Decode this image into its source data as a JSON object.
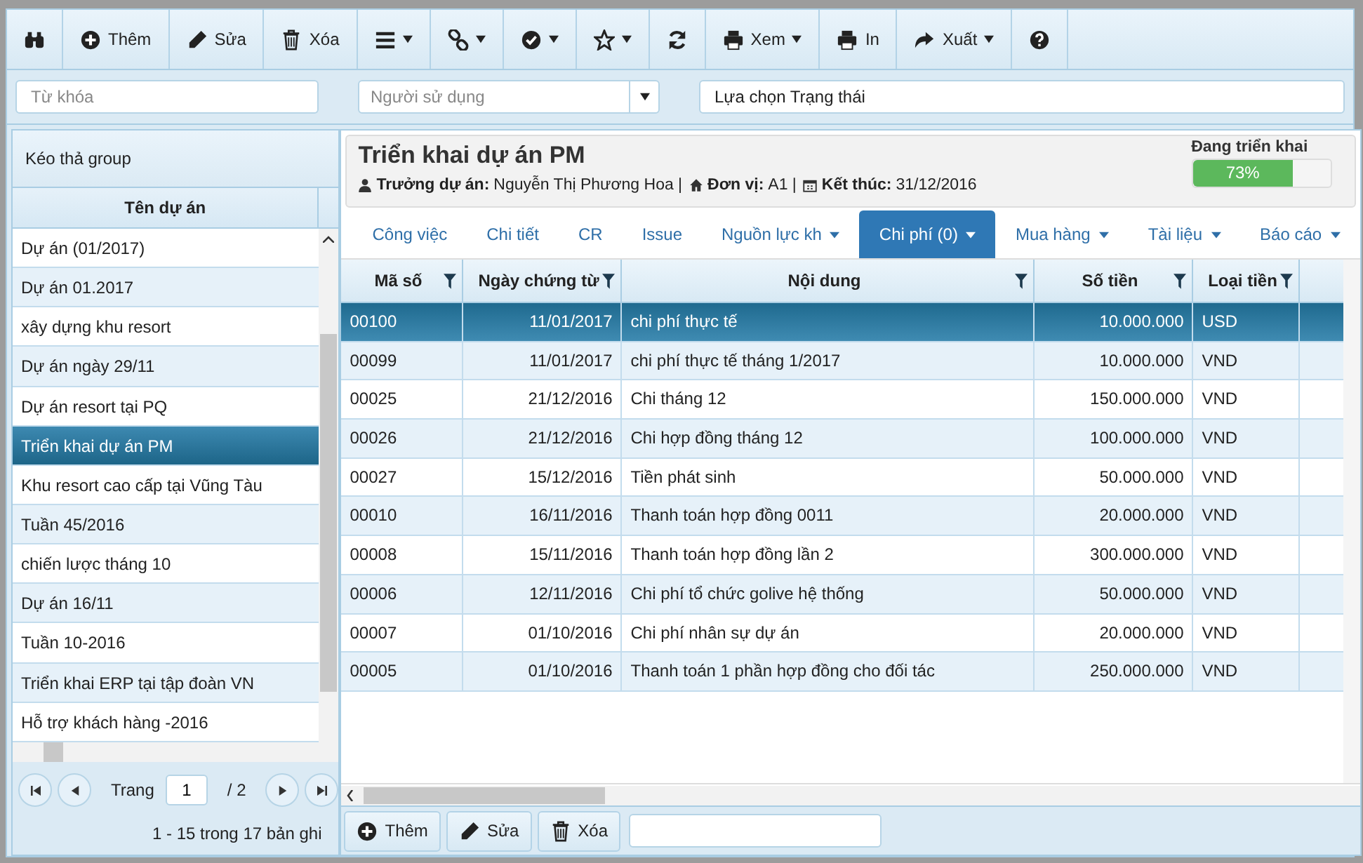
{
  "toolbar": [
    {
      "kind": "binoculars",
      "caret": false
    },
    {
      "kind": "plus",
      "label": "Thêm",
      "caret": false
    },
    {
      "kind": "pencil",
      "label": "Sửa",
      "caret": false
    },
    {
      "kind": "trash",
      "label": "Xóa",
      "caret": false
    },
    {
      "kind": "list",
      "caret": true
    },
    {
      "kind": "link",
      "caret": true
    },
    {
      "kind": "check",
      "caret": true
    },
    {
      "kind": "star",
      "caret": true
    },
    {
      "kind": "refresh",
      "caret": false
    },
    {
      "kind": "printer",
      "label": "Xem",
      "caret": true
    },
    {
      "kind": "printer",
      "label": "In",
      "caret": false
    },
    {
      "kind": "share",
      "label": "Xuất",
      "caret": true
    },
    {
      "kind": "help",
      "caret": false
    }
  ],
  "filters": {
    "keyword": {
      "placeholder": "Từ khóa"
    },
    "user": {
      "placeholder": "Người sử dụng"
    },
    "status": {
      "value": "Lựa chọn Trạng thái"
    }
  },
  "project_list": {
    "group_hint": "Kéo thả group",
    "column": "Tên dự án",
    "items": [
      {
        "name": "Dự án (01/2017)",
        "selected": false
      },
      {
        "name": "Dự án 01.2017",
        "selected": false
      },
      {
        "name": "xây dựng khu resort",
        "selected": false
      },
      {
        "name": "Dự án ngày 29/11",
        "selected": false
      },
      {
        "name": "Dự án resort tại PQ",
        "selected": false
      },
      {
        "name": "Triển khai dự án PM",
        "selected": true
      },
      {
        "name": "Khu resort cao cấp tại Vũng Tàu",
        "selected": false
      },
      {
        "name": "Tuần 45/2016",
        "selected": false
      },
      {
        "name": "chiến lược tháng 10",
        "selected": false
      },
      {
        "name": "Dự án 16/11",
        "selected": false
      },
      {
        "name": "Tuần 10-2016",
        "selected": false
      },
      {
        "name": "Triển khai ERP tại tập đoàn VN",
        "selected": false
      },
      {
        "name": "Hỗ trợ khách hàng -2016",
        "selected": false
      }
    ],
    "pager": {
      "label": "Trang",
      "page": "1",
      "total": "/ 2",
      "summary": "1 - 15 trong 17 bản ghi"
    }
  },
  "project": {
    "title": "Triển khai dự án PM",
    "meta": [
      {
        "kind": "user",
        "label": "Trưởng dự án:",
        "value": "Nguyễn Thị Phương Hoa |"
      },
      {
        "kind": "home",
        "label": "Đơn vị:",
        "value": "A1 |"
      },
      {
        "kind": "calendar",
        "label": "Kết thúc:",
        "value": "31/12/2016"
      }
    ],
    "status": {
      "label": "Đang triển khai",
      "level": 0.73,
      "reading": "73%"
    }
  },
  "tabs": [
    {
      "label": "Công việc",
      "dropdown": false,
      "selected": false
    },
    {
      "label": "Chi tiết",
      "dropdown": false,
      "selected": false
    },
    {
      "label": "CR",
      "dropdown": false,
      "selected": false
    },
    {
      "label": "Issue",
      "dropdown": false,
      "selected": false
    },
    {
      "label": "Nguồn lực kh",
      "dropdown": true,
      "selected": false
    },
    {
      "label": "Chi phí (0)",
      "dropdown": true,
      "selected": true
    },
    {
      "label": "Mua hàng",
      "dropdown": true,
      "selected": false
    },
    {
      "label": "Tài liệu",
      "dropdown": true,
      "selected": false
    },
    {
      "label": "Báo cáo",
      "dropdown": true,
      "selected": false
    }
  ],
  "table": {
    "columns": [
      "Mã số",
      "Ngày chứng từ",
      "Nội dung",
      "Số tiền",
      "Loại tiền"
    ],
    "rows": [
      {
        "cells": [
          "00100",
          "11/01/2017",
          "chi phí thực tế",
          "10.000.000",
          "USD"
        ],
        "selected": true
      },
      {
        "cells": [
          "00099",
          "11/01/2017",
          "chi phí thực tế tháng 1/2017",
          "10.000.000",
          "VND"
        ],
        "selected": false
      },
      {
        "cells": [
          "00025",
          "21/12/2016",
          "Chi tháng 12",
          "150.000.000",
          "VND"
        ],
        "selected": false
      },
      {
        "cells": [
          "00026",
          "21/12/2016",
          "Chi hợp đồng tháng 12",
          "100.000.000",
          "VND"
        ],
        "selected": false
      },
      {
        "cells": [
          "00027",
          "15/12/2016",
          "Tiền phát sinh",
          "50.000.000",
          "VND"
        ],
        "selected": false
      },
      {
        "cells": [
          "00010",
          "16/11/2016",
          "Thanh toán hợp đồng 0011",
          "20.000.000",
          "VND"
        ],
        "selected": false
      },
      {
        "cells": [
          "00008",
          "15/11/2016",
          "Thanh toán hợp đồng lần 2",
          "300.000.000",
          "VND"
        ],
        "selected": false
      },
      {
        "cells": [
          "00006",
          "12/11/2016",
          "Chi phí tổ chức golive hệ thống",
          "50.000.000",
          "VND"
        ],
        "selected": false
      },
      {
        "cells": [
          "00007",
          "01/10/2016",
          "Chi phí nhân sự dự án",
          "20.000.000",
          "VND"
        ],
        "selected": false
      },
      {
        "cells": [
          "00005",
          "01/10/2016",
          "Thanh toán 1 phần hợp đồng cho đối tác",
          "250.000.000",
          "VND"
        ],
        "selected": false
      }
    ]
  },
  "bottom_toolbar": [
    {
      "kind": "plus",
      "label": "Thêm"
    },
    {
      "kind": "pencil",
      "label": "Sửa"
    },
    {
      "kind": "trash",
      "label": "Xóa"
    }
  ]
}
